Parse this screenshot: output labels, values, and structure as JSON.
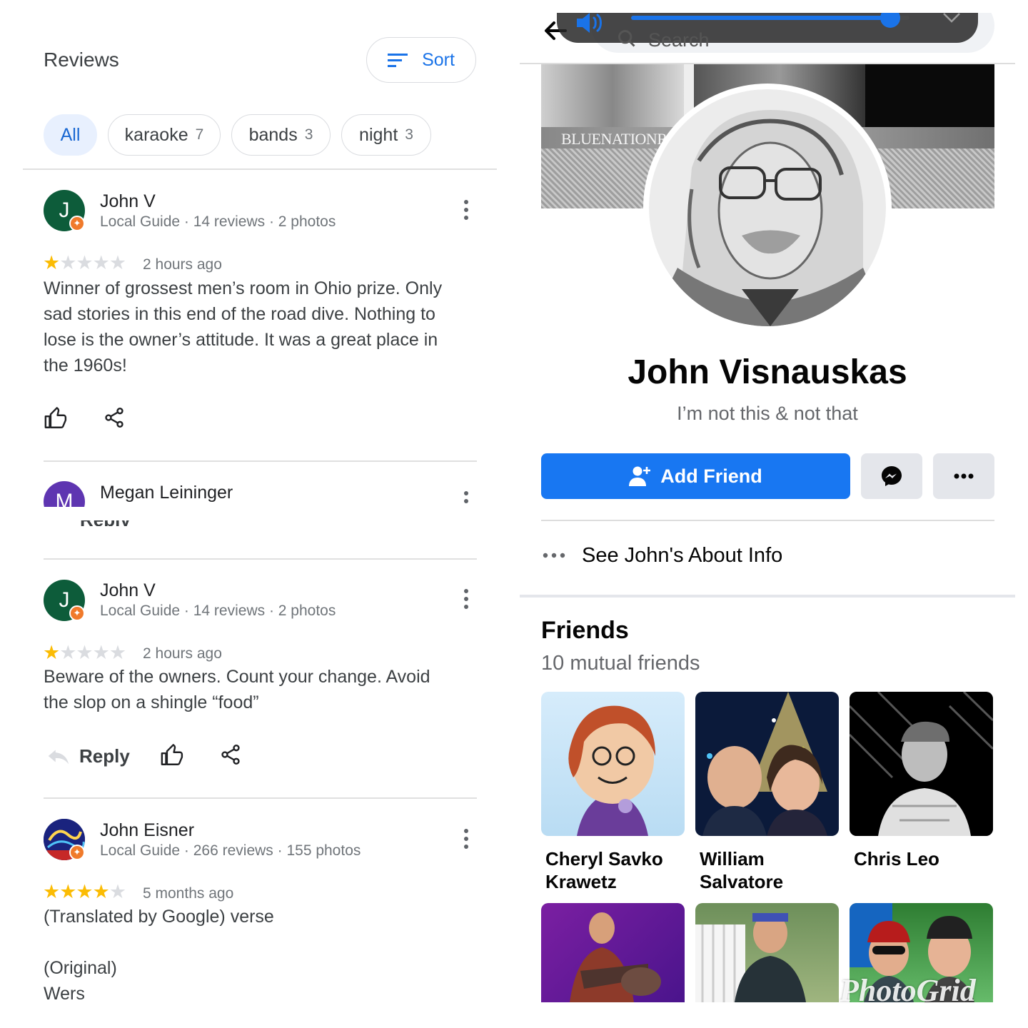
{
  "reviews": {
    "title": "Reviews",
    "sort_label": "Sort",
    "chips": [
      {
        "label": "All",
        "count": ""
      },
      {
        "label": "karaoke",
        "count": "7"
      },
      {
        "label": "bands",
        "count": "3"
      },
      {
        "label": "night",
        "count": "3"
      }
    ],
    "items": [
      {
        "initial": "J",
        "name": "John V",
        "meta": "Local Guide · 14 reviews · 2 photos",
        "rating": 1,
        "time": "2 hours ago",
        "text": "Winner of grossest men’s room in Ohio prize. Only sad stories in this end of the road dive. Nothing to lose is the owner’s attitude. It was a great place in the 1960s!"
      },
      {
        "initial": "M",
        "name": "Megan Leininger"
      },
      {
        "initial": "J",
        "name": "John V",
        "meta": "Local Guide · 14 reviews · 2 photos",
        "rating": 1,
        "time": "2 hours ago",
        "text": "Beware of the owners. Count your change. Avoid the slop on a shingle “food”",
        "reply_label": "Reply"
      },
      {
        "name": "John Eisner",
        "meta": "Local Guide · 266 reviews · 155 photos",
        "rating": 4,
        "time": "5 months ago",
        "text_translated": "(Translated by Google) verse",
        "text_original_label": "(Original)",
        "text_original": "Wers"
      }
    ],
    "cut_reply_label": "Reply"
  },
  "audio_overlay": {
    "search_placeholder": "Search",
    "volume_level": 0.93
  },
  "profile": {
    "cover_text": "BLUENATIONRE",
    "name": "John Visnauskas",
    "bio": "I’m not this & not that",
    "add_friend_label": "Add Friend",
    "about_label": "See John's About Info",
    "friends_title": "Friends",
    "mutual_friends": "10 mutual friends",
    "friends": [
      {
        "name": "Cheryl Savko Krawetz"
      },
      {
        "name": "William Salvatore"
      },
      {
        "name": "Chris Leo"
      }
    ]
  },
  "watermark": "PhotoGrid",
  "colors": {
    "facebook_blue": "#1877f2",
    "google_blue": "#1a73e8",
    "star": "#fbbc04",
    "local_guide_badge": "#f07a2b",
    "avatar_green": "#0d5c3a",
    "avatar_purple": "#5e35b1"
  }
}
